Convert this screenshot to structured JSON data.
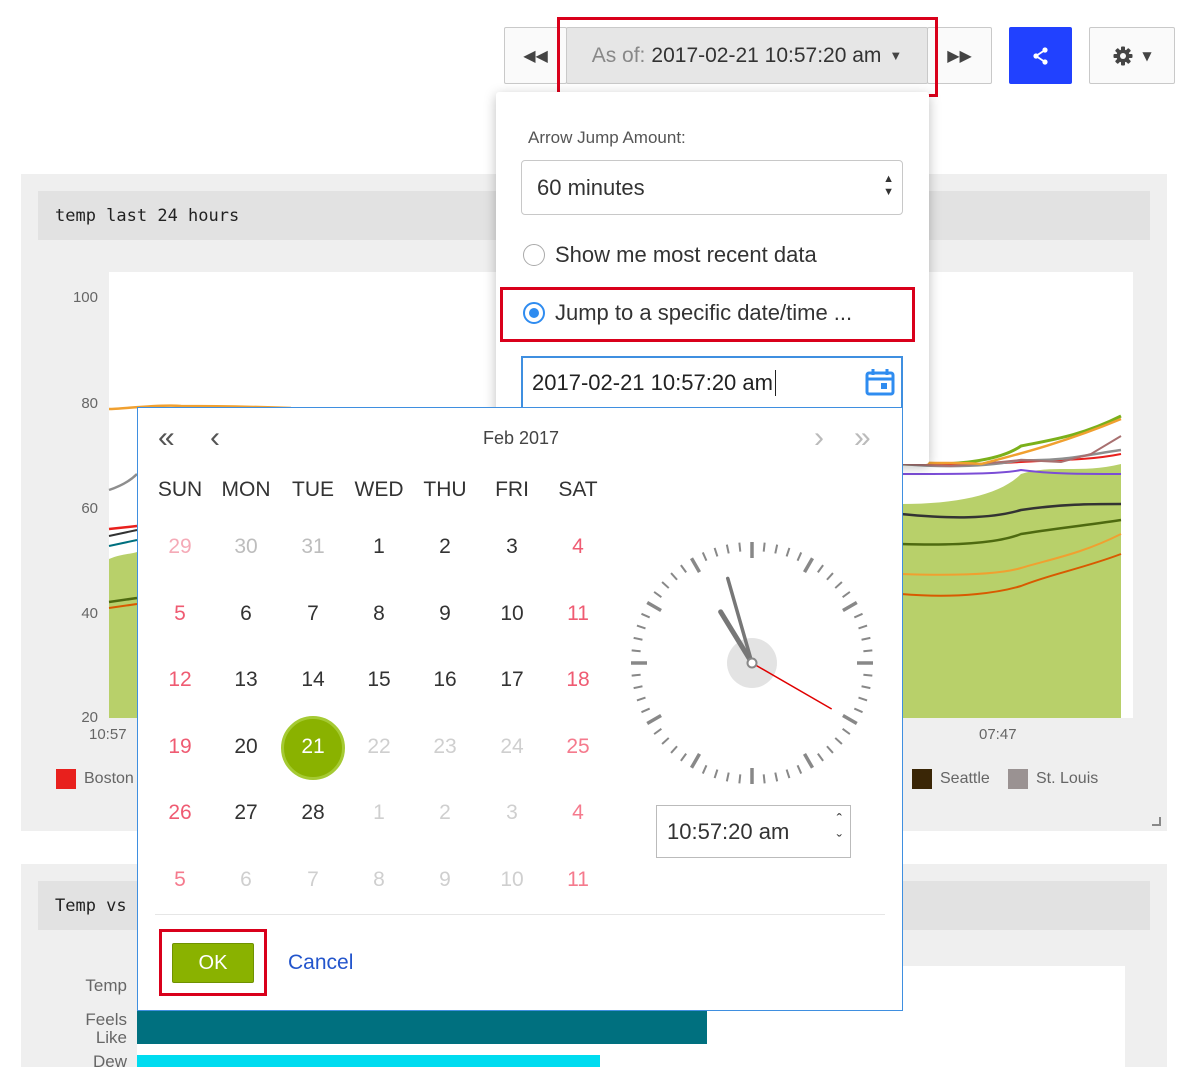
{
  "toolbar": {
    "asof_label": "As of:",
    "asof_value": "2017-02-21 10:57:20 am",
    "share_color": "#2141ff"
  },
  "panel1": {
    "title": "temp last 24 hours",
    "y_ticks": [
      "100",
      "80",
      "60",
      "40",
      "20"
    ],
    "x_ticks": [
      "10:57",
      "07:47"
    ],
    "legend": [
      {
        "label": "Boston",
        "color": "#e8201d"
      },
      {
        "label": "Seattle",
        "color": "#3a2606"
      },
      {
        "label": "St. Louis",
        "color": "#9a9292"
      }
    ]
  },
  "panel2": {
    "title": "Temp vs",
    "bar_labels": [
      "Temp",
      "Feels Like",
      "Dew"
    ],
    "bar_colors": [
      "#00707f",
      "#00dcf0"
    ]
  },
  "dropdown": {
    "jump_label": "Arrow Jump Amount:",
    "jump_value": "60 minutes",
    "option_recent": "Show me most recent data",
    "option_specific": "Jump to a specific date/time ...",
    "date_value": "2017-02-21 10:57:20 am"
  },
  "picker": {
    "month": "Feb 2017",
    "weekdays": [
      "SUN",
      "MON",
      "TUE",
      "WED",
      "THU",
      "FRI",
      "SAT"
    ],
    "weeks": [
      [
        "29",
        "30",
        "31",
        "1",
        "2",
        "3",
        "4"
      ],
      [
        "5",
        "6",
        "7",
        "8",
        "9",
        "10",
        "11"
      ],
      [
        "12",
        "13",
        "14",
        "15",
        "16",
        "17",
        "18"
      ],
      [
        "19",
        "20",
        "21",
        "22",
        "23",
        "24",
        "25"
      ],
      [
        "26",
        "27",
        "28",
        "1",
        "2",
        "3",
        "4"
      ],
      [
        "5",
        "6",
        "7",
        "8",
        "9",
        "10",
        "11"
      ]
    ],
    "selected_day": "21",
    "time_value": "10:57:20 am",
    "clock": {
      "hour": 10,
      "minute": 57,
      "second": 20
    },
    "ok_label": "OK",
    "cancel_label": "Cancel"
  }
}
